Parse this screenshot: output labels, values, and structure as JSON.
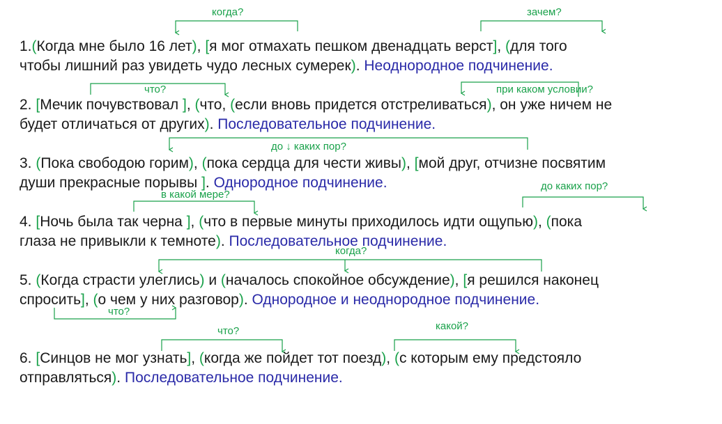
{
  "colors": {
    "bracket": "#19a14a",
    "conclusion": "#2a2aa8",
    "text": "#1a1a1a"
  },
  "s1": {
    "l1": [
      "1.",
      "(",
      "Когда мне было 16 лет",
      ")",
      ", ",
      "[",
      "я мог отмахать пешком двенадцать верст",
      "]",
      ", ",
      "(",
      "для того"
    ],
    "l2": [
      "чтобы лишний раз увидеть чудо лесных сумерек",
      ")",
      ". ",
      "Неоднородное подчинение."
    ],
    "q1": "когда?",
    "q2": "зачем?"
  },
  "s2": {
    "l1": [
      "2. ",
      "[",
      "Мечик почувствовал ",
      "]",
      ", ",
      "(",
      "что, ",
      "(",
      "если вновь придется отстреливаться",
      ")",
      ", он уже ничем не"
    ],
    "l2": [
      "будет отличаться от других",
      ")",
      ". ",
      "Последовательное подчинение."
    ],
    "q1": "что?",
    "q2": "при каком условии?"
  },
  "s3": {
    "l1": [
      "3. ",
      "(",
      "Пока свободою горим",
      ")",
      ", ",
      "(",
      "пока сердца для чести живы",
      ")",
      ", ",
      "[",
      "мой друг, отчизне посвятим"
    ],
    "l2": [
      "души прекрасные порывы ",
      "]",
      ". ",
      "Однородное подчинение."
    ],
    "q1": "до ↓  каких пор?"
  },
  "s4": {
    "l1": [
      "4. ",
      "[",
      "Ночь была так черна ",
      "]",
      ", ",
      "(",
      "что в первые минуты приходилось идти ощупью",
      ")",
      ", ",
      "(",
      "пока"
    ],
    "l2": [
      "глаза не привыкли к темноте",
      ")",
      ". ",
      "Последовательное подчинение."
    ],
    "q1": "в какой мере?",
    "q2": "до каких пор?"
  },
  "s5": {
    "l1": [
      "5. ",
      "(",
      "Когда страсти улеглись",
      ")",
      " и ",
      "(",
      "началось спокойное обсуждение",
      ")",
      ", ",
      "[",
      "я решился наконец"
    ],
    "l2": [
      "спросить",
      "]",
      ", ",
      "(",
      "о чем у них разговор",
      ")",
      ". ",
      "Однородное и неоднородное подчинение."
    ],
    "q1": "когда?",
    "q2": "что?"
  },
  "s6": {
    "l1": [
      "6. ",
      "[",
      "Синцов не мог узнать",
      "]",
      ", ",
      "(",
      "когда же пойдет тот поезд",
      ")",
      ", ",
      "(",
      "с которым ему предстояло"
    ],
    "l2": [
      "отправляться",
      ")",
      ". ",
      "Последовательное подчинение."
    ],
    "q1": "что?",
    "q2": "какой?"
  }
}
